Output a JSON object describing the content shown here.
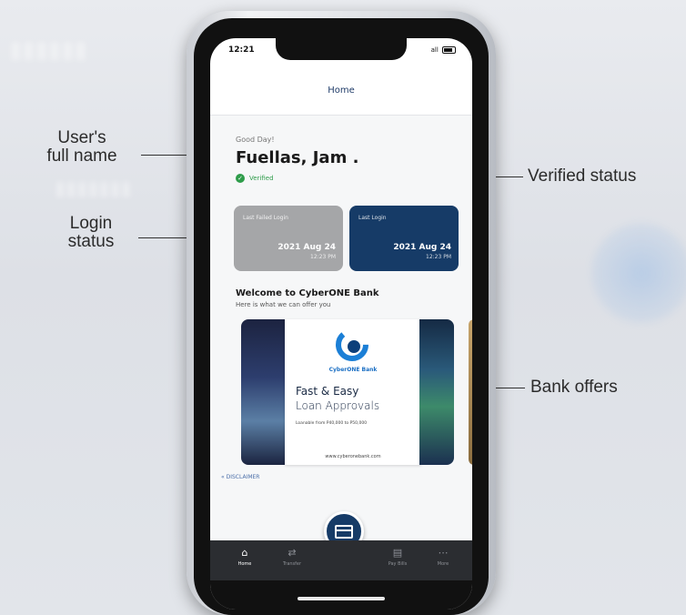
{
  "annotations": {
    "user_full_name": "User's\nfull name",
    "verified_status": "Verified status",
    "login_status": "Login\nstatus",
    "bank_offers": "Bank offers"
  },
  "statusbar": {
    "time": "12:21",
    "signal": "all",
    "battery_icon": "battery-icon"
  },
  "header": {
    "title": "Home"
  },
  "profile": {
    "greeting": "Good Day!",
    "full_name": "Fuellas, Jam .",
    "verified_label": "Verified"
  },
  "login_cards": [
    {
      "title": "Last Failed Login",
      "date": "2021 Aug 24",
      "time": "12:23 PM",
      "color": "#a5a6a8"
    },
    {
      "title": "Last Login",
      "date": "2021 Aug 24",
      "time": "12:23 PM",
      "color": "#163b67"
    }
  ],
  "welcome": {
    "title": "Welcome to CyberONE Bank",
    "subtitle": "Here is what we can offer you"
  },
  "offer": {
    "brand": "CyberONE Bank",
    "headline_1": "Fast & Easy",
    "headline_2": "Loan Approvals",
    "fine_print": "Loanable from P40,000 to P50,000",
    "url": "www.cyberonebank.com"
  },
  "disclaimer": "« DISCLAIMER",
  "tabs": [
    {
      "label": "Home",
      "icon": "home-icon",
      "active": true
    },
    {
      "label": "Transfer",
      "icon": "transfer-icon",
      "active": false
    },
    {
      "label": "Pay Bills",
      "icon": "bills-icon",
      "active": false
    },
    {
      "label": "More",
      "icon": "more-icon",
      "active": false
    }
  ],
  "fab": {
    "icon": "card-icon"
  },
  "colors": {
    "brand_navy": "#163b67",
    "verified_green": "#2e9c4a",
    "card_gray": "#a5a6a8"
  }
}
